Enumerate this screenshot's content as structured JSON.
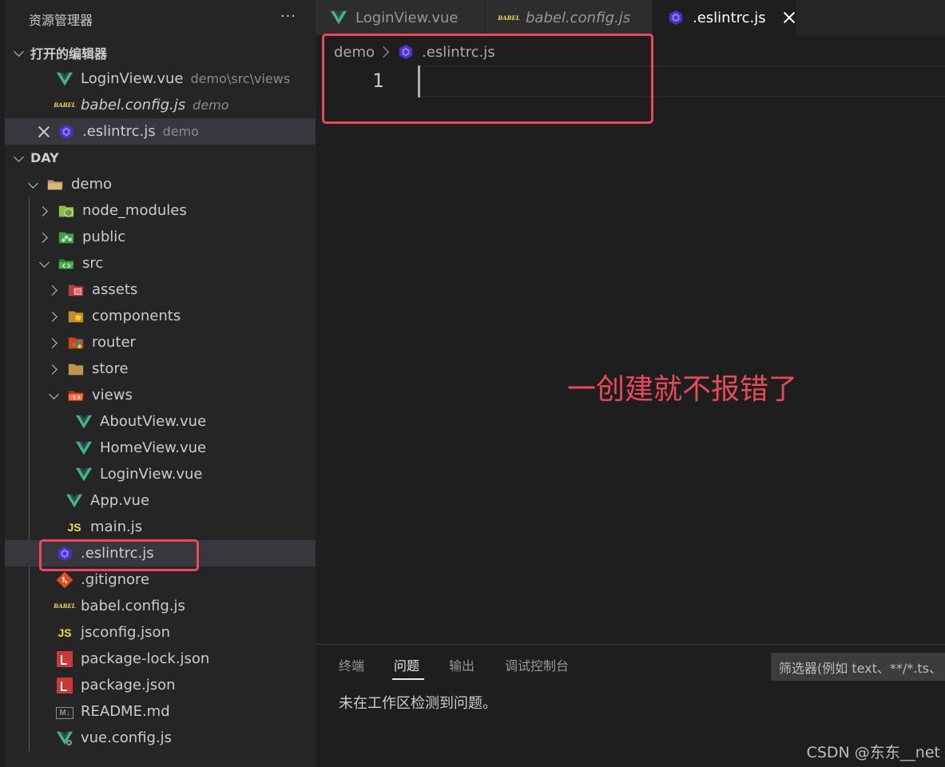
{
  "explorer": {
    "title": "资源管理器",
    "more_icon": "ellipsis-icon",
    "open_editors": {
      "section_label": "打开的编辑器",
      "items": [
        {
          "name": "LoginView.vue",
          "desc": "demo\\src\\views",
          "icon": "vue-icon"
        },
        {
          "name": "babel.config.js",
          "desc": "demo",
          "icon": "babel-icon"
        },
        {
          "name": ".eslintrc.js",
          "desc": "demo",
          "icon": "eslint-icon"
        }
      ]
    },
    "workspace": {
      "section_label": "DAY",
      "items": [
        {
          "name": "demo",
          "icon": "folder-icon"
        },
        {
          "name": "node_modules",
          "icon": "node-folder-icon"
        },
        {
          "name": "public",
          "icon": "public-folder-icon"
        },
        {
          "name": "src",
          "icon": "src-folder-icon"
        },
        {
          "name": "assets",
          "icon": "assets-folder-icon"
        },
        {
          "name": "components",
          "icon": "components-folder-icon"
        },
        {
          "name": "router",
          "icon": "router-folder-icon"
        },
        {
          "name": "store",
          "icon": "store-folder-icon"
        },
        {
          "name": "views",
          "icon": "views-folder-icon"
        },
        {
          "name": "AboutView.vue",
          "icon": "vue-icon"
        },
        {
          "name": "HomeView.vue",
          "icon": "vue-icon"
        },
        {
          "name": "LoginView.vue",
          "icon": "vue-icon"
        },
        {
          "name": "App.vue",
          "icon": "vue-icon"
        },
        {
          "name": "main.js",
          "icon": "js-icon"
        },
        {
          "name": ".eslintrc.js",
          "icon": "eslint-icon"
        },
        {
          "name": ".gitignore",
          "icon": "git-icon"
        },
        {
          "name": "babel.config.js",
          "icon": "babel-icon"
        },
        {
          "name": "jsconfig.json",
          "icon": "jsconfig-icon"
        },
        {
          "name": "package-lock.json",
          "icon": "npm-icon"
        },
        {
          "name": "package.json",
          "icon": "npm-icon"
        },
        {
          "name": "README.md",
          "icon": "markdown-icon"
        },
        {
          "name": "vue.config.js",
          "icon": "vue-config-icon"
        }
      ]
    }
  },
  "tabs": [
    {
      "label": "LoginView.vue",
      "icon": "vue-icon"
    },
    {
      "label": "babel.config.js",
      "icon": "babel-icon"
    },
    {
      "label": ".eslintrc.js",
      "icon": "eslint-icon"
    }
  ],
  "babel_icon_text": "BABEL",
  "js_icon_text": "JS",
  "md_icon_text": "M↓",
  "editor": {
    "breadcrumb": [
      "demo",
      ".eslintrc.js"
    ],
    "line_number": "1"
  },
  "annotation": "一创建就不报错了",
  "panel": {
    "tabs": [
      "终端",
      "问题",
      "输出",
      "调试控制台"
    ],
    "filter_label": "筛选器(例如 text、**/*.ts、",
    "message": "未在工作区检测到问题。"
  },
  "watermark": "CSDN @东东__net",
  "colors": {
    "accent_red": "#e8495b",
    "vue_green": "#41b883",
    "eslint_purple": "#8080f2"
  }
}
